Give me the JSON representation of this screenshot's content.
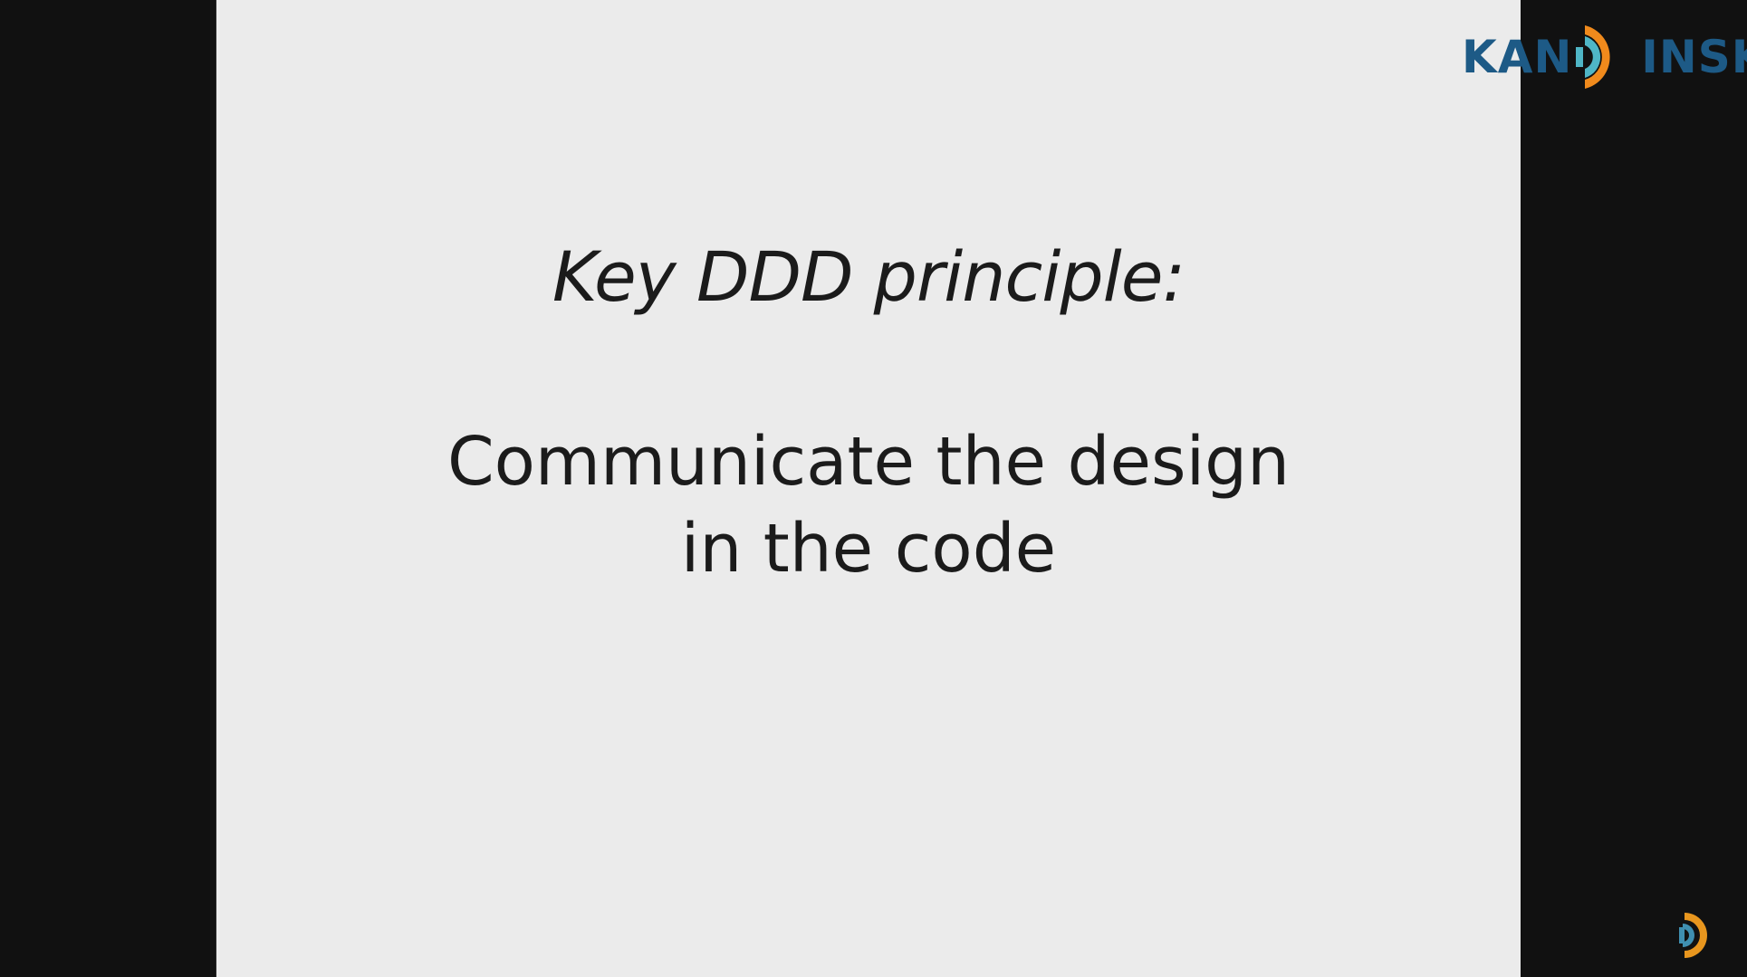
{
  "slide": {
    "heading": "Key DDD principle:",
    "body_lines": [
      "Communicate the design",
      "in the code"
    ]
  },
  "logo": {
    "prefix": "KAN",
    "suffix": "INSKY",
    "icon": "d-swirl-icon",
    "colors": {
      "text": "#1d5a86",
      "orange": "#f08a1c",
      "teal": "#4fb6c6"
    }
  },
  "corner_watermark": {
    "icon": "d-swirl-icon",
    "colors": {
      "orange": "#e8961e",
      "teal": "#3f8fb0"
    }
  }
}
